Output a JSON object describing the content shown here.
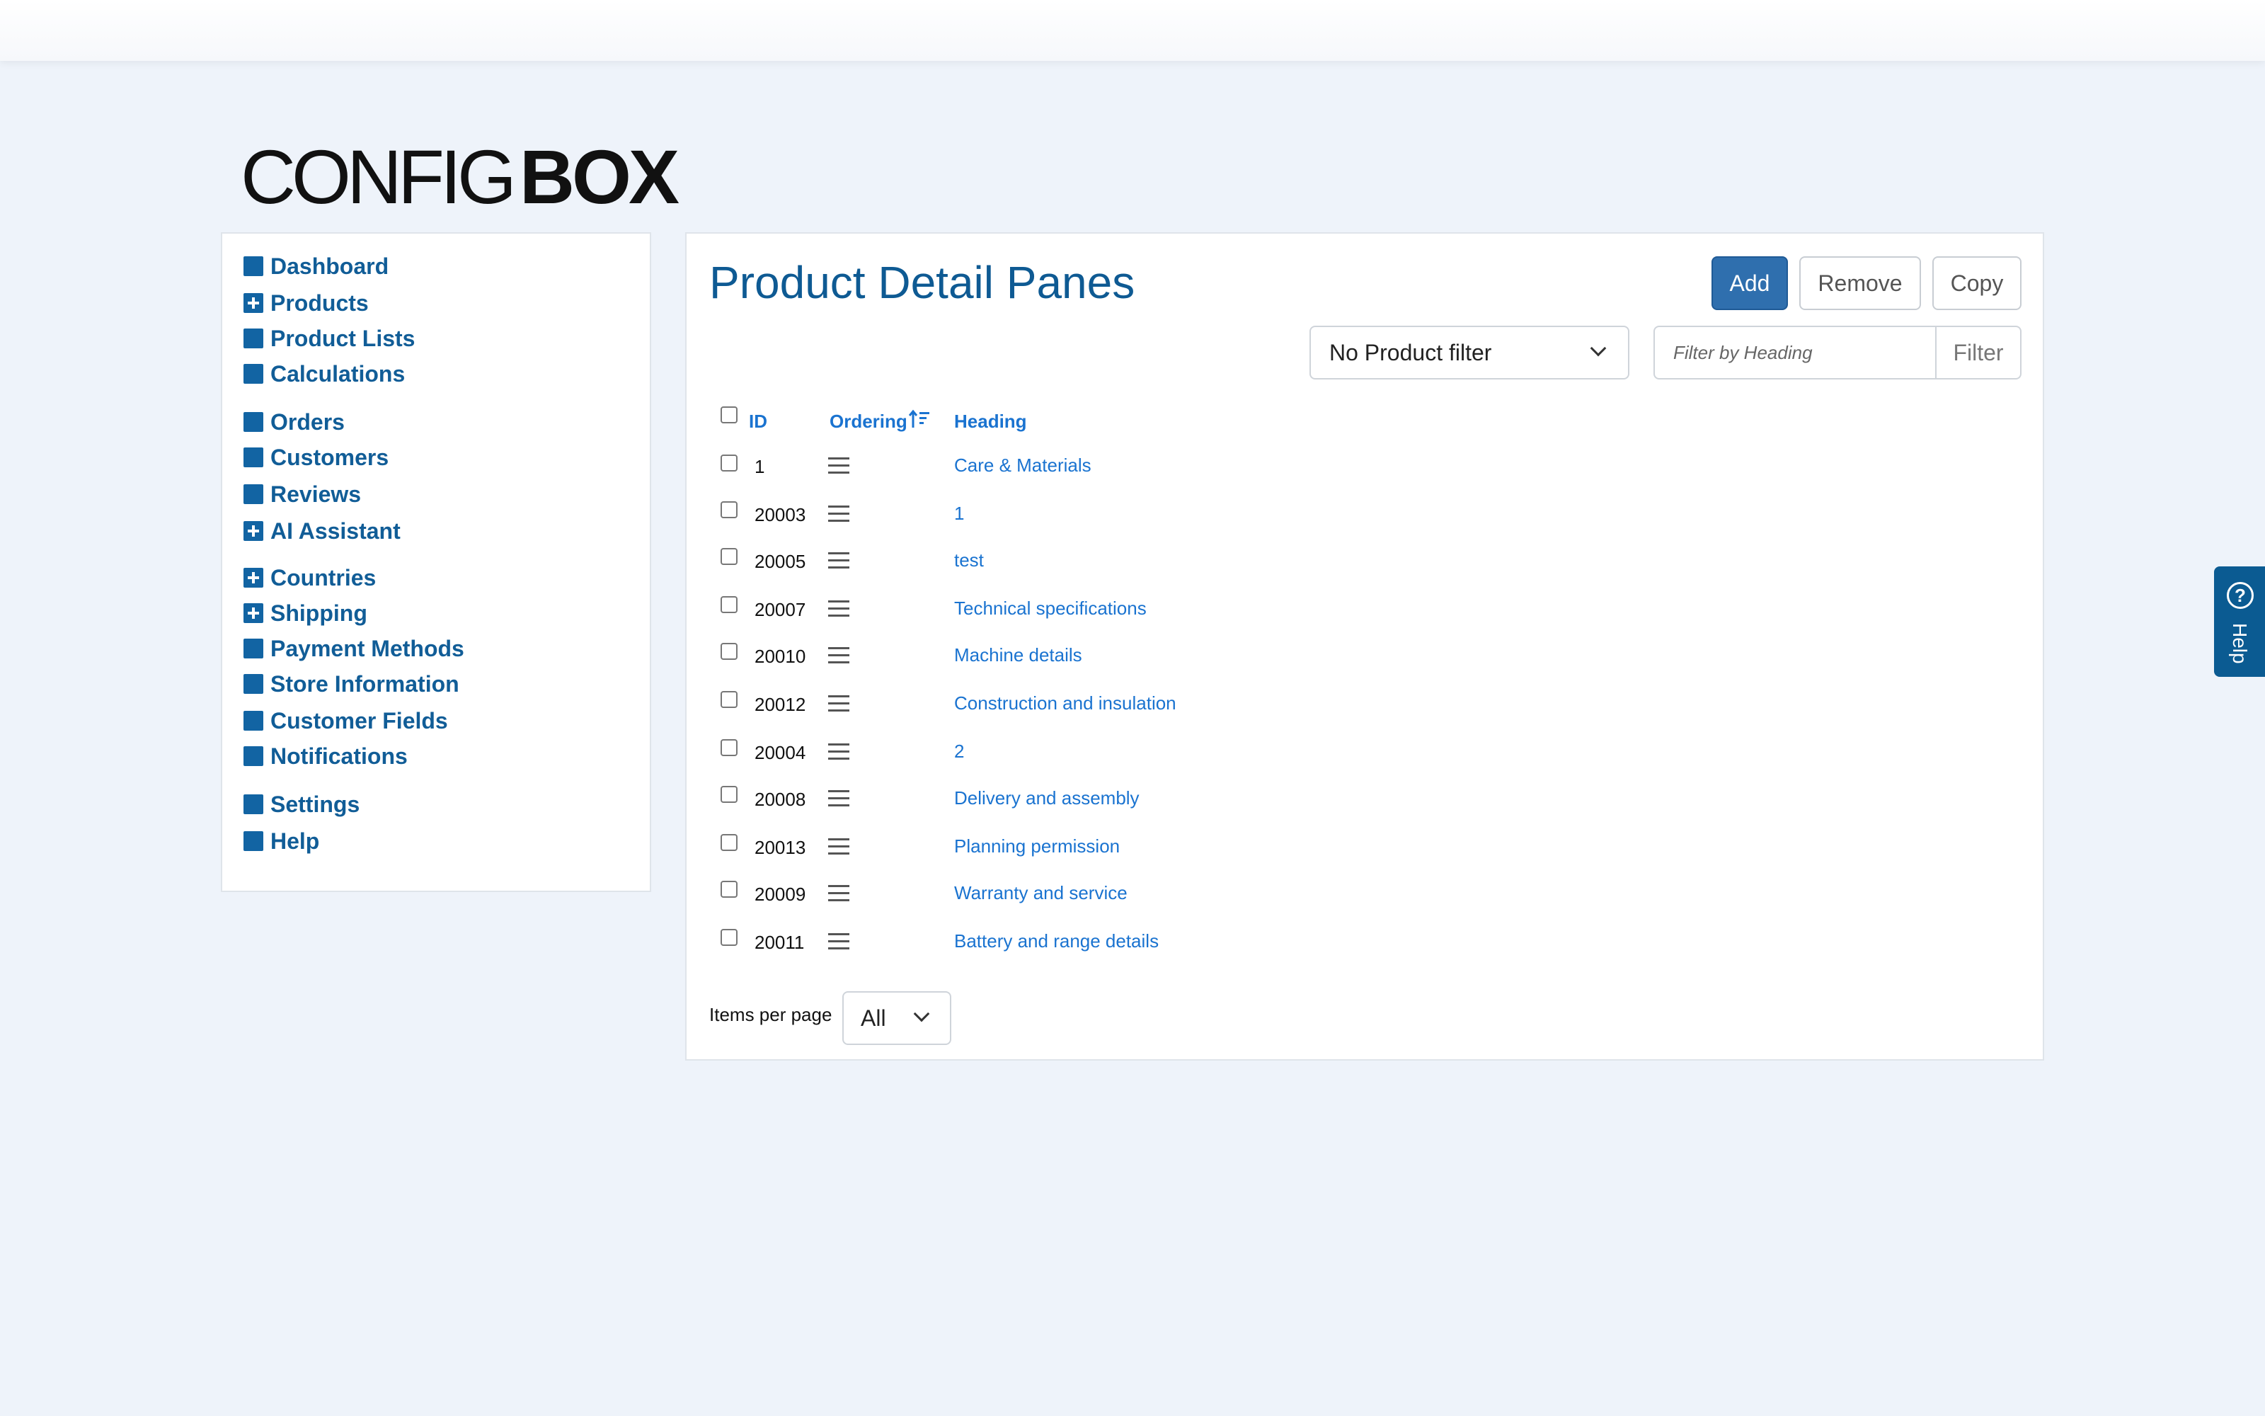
{
  "logo": {
    "part1": "CONFIG",
    "part2": "BOX"
  },
  "sidebar": {
    "items": [
      {
        "label": "Dashboard",
        "icon": "square-icon"
      },
      {
        "label": "Products",
        "icon": "plus-square-icon"
      },
      {
        "label": "Product Lists",
        "icon": "square-icon"
      },
      {
        "label": "Calculations",
        "icon": "square-icon"
      },
      {
        "label": "Orders",
        "icon": "square-icon"
      },
      {
        "label": "Customers",
        "icon": "square-icon"
      },
      {
        "label": "Reviews",
        "icon": "square-icon"
      },
      {
        "label": "AI Assistant",
        "icon": "plus-square-icon"
      },
      {
        "label": "Countries",
        "icon": "plus-square-icon"
      },
      {
        "label": "Shipping",
        "icon": "plus-square-icon"
      },
      {
        "label": "Payment Methods",
        "icon": "square-icon"
      },
      {
        "label": "Store Information",
        "icon": "square-icon"
      },
      {
        "label": "Customer Fields",
        "icon": "square-icon"
      },
      {
        "label": "Notifications",
        "icon": "square-icon"
      },
      {
        "label": "Settings",
        "icon": "square-icon"
      },
      {
        "label": "Help",
        "icon": "square-icon"
      }
    ]
  },
  "main": {
    "title": "Product Detail Panes",
    "buttons": {
      "add": "Add",
      "remove": "Remove",
      "copy": "Copy"
    },
    "product_filter": {
      "selected": "No Product filter"
    },
    "heading_filter": {
      "placeholder": "Filter by Heading",
      "button": "Filter"
    },
    "table": {
      "columns": {
        "id": "ID",
        "ordering": "Ordering",
        "heading": "Heading"
      },
      "rows": [
        {
          "id": "1",
          "heading": "Care & Materials"
        },
        {
          "id": "20003",
          "heading": "1"
        },
        {
          "id": "20005",
          "heading": "test"
        },
        {
          "id": "20007",
          "heading": "Technical specifications"
        },
        {
          "id": "20010",
          "heading": "Machine details"
        },
        {
          "id": "20012",
          "heading": "Construction and insulation"
        },
        {
          "id": "20004",
          "heading": "2"
        },
        {
          "id": "20008",
          "heading": "Delivery and assembly"
        },
        {
          "id": "20013",
          "heading": "Planning permission"
        },
        {
          "id": "20009",
          "heading": "Warranty and service"
        },
        {
          "id": "20011",
          "heading": "Battery and range details"
        }
      ]
    },
    "items_per_page": {
      "label": "Items per page",
      "selected": "All"
    }
  },
  "help_tab": {
    "label": "Help",
    "glyph": "?"
  },
  "colors": {
    "brand": "#115d97",
    "link": "#1a73d0",
    "primary_button": "#2f6fae",
    "background": "#eef3fa"
  }
}
